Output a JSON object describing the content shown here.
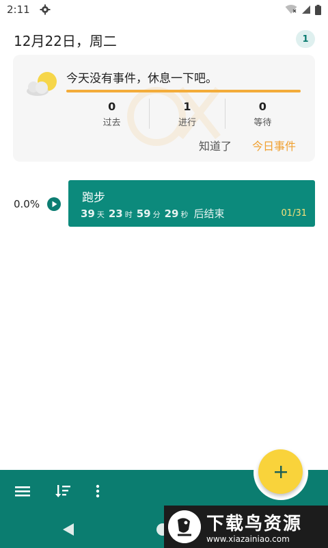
{
  "status_bar": {
    "time": "2:11"
  },
  "header": {
    "date": "12月22日，周二",
    "badge_count": "1"
  },
  "today_card": {
    "message": "今天没有事件，休息一下吧。",
    "stats": [
      {
        "value": "0",
        "label": "过去"
      },
      {
        "value": "1",
        "label": "进行"
      },
      {
        "value": "0",
        "label": "等待"
      }
    ],
    "ack_label": "知道了",
    "today_label": "今日事件"
  },
  "event": {
    "progress": "0.0%",
    "title": "跑步",
    "countdown": {
      "days": "39",
      "days_unit": "天",
      "hours": "23",
      "hours_unit": "时",
      "minutes": "59",
      "minutes_unit": "分",
      "seconds": "29",
      "seconds_unit": "秒",
      "suffix": "后结束"
    },
    "page": "01/31"
  },
  "brand": {
    "name": "下载鸟资源",
    "url": "www.xiazainiao.com"
  },
  "colors": {
    "accent": "#0b7d70",
    "progress": "#f3ac3a",
    "fab": "#f9d33b",
    "today_button": "#f0a030"
  }
}
